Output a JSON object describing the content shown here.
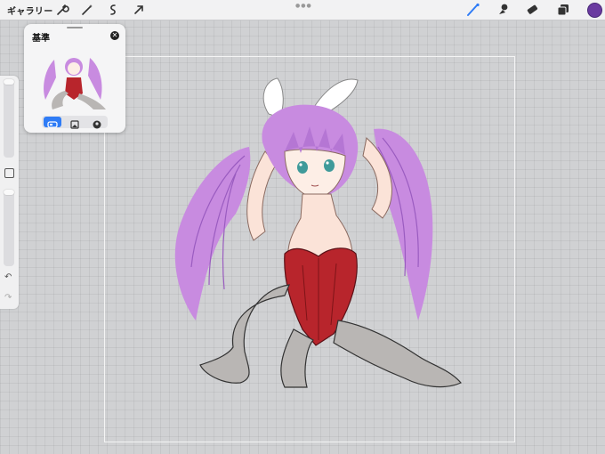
{
  "toolbar": {
    "gallery_label": "ギャラリー",
    "left_icons": [
      "wrench-icon",
      "magic-wand-icon",
      "selection-icon",
      "transform-arrow-icon"
    ],
    "right_icons": [
      "brush-icon",
      "smudge-icon",
      "eraser-icon",
      "layers-icon"
    ],
    "current_color": "#6a3aa0"
  },
  "sidebar": {
    "brush_size_slider": "brush-size-slider",
    "opacity_slider": "opacity-slider",
    "modify_button": "modify-button",
    "undo_icon": "undo-icon",
    "redo_icon": "redo-icon"
  },
  "reference": {
    "title": "基準",
    "close_icon": "close-icon",
    "tabs": [
      "canvas-tab",
      "image-tab",
      "face-tab"
    ],
    "active_tab": "canvas-tab"
  },
  "colors": {
    "accent": "#2f7cf6",
    "hair": "#c88be0",
    "leotard": "#b8252c",
    "tights": "#b9b6b4"
  }
}
